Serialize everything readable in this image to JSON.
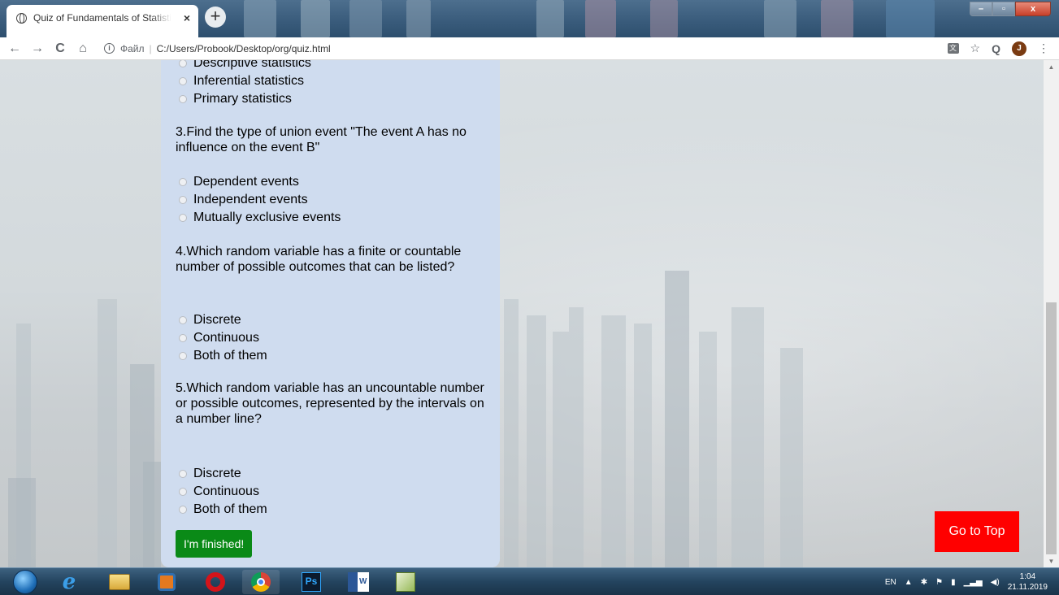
{
  "browser": {
    "tab_title": "Quiz of Fundamentals of Statistic",
    "tab_close": "×",
    "new_tab": "+",
    "window_min": "–",
    "window_max": "▫",
    "window_close": "x"
  },
  "toolbar": {
    "back": "←",
    "forward": "→",
    "reload": "C",
    "home": "⌂",
    "info": "i",
    "scheme_label": "Файл",
    "separator": "|",
    "url": "C:/Users/Probook/Desktop/org/quiz.html",
    "star": "☆",
    "search": "Q",
    "avatar_letter": "J",
    "menu": "⋮"
  },
  "quiz": {
    "partial_options": [
      "Descriptive statistics",
      "Inferential statistics",
      "Primary statistics"
    ],
    "questions": [
      {
        "text": "3.Find the type of union event \"The event A has no influence on the event B\"",
        "options": [
          "Dependent events",
          "Independent events",
          "Mutually exclusive events"
        ]
      },
      {
        "text": "4.Which random variable has a finite or countable number of possible outcomes that can be listed?",
        "options": [
          "Discrete",
          "Continuous",
          "Both of them"
        ]
      },
      {
        "text": "5.Which random variable has an uncountable number or possible outcomes, represented by the intervals on a number line?",
        "options": [
          "Discrete",
          "Continuous",
          "Both of them"
        ]
      }
    ],
    "finish_label": "I'm finished!",
    "go_top_label": "Go to Top"
  },
  "taskbar": {
    "ps_label": "Ps",
    "word_label": "W",
    "language": "EN",
    "time": "1:04",
    "date": "21.11.2019"
  },
  "colors": {
    "panel": "#cfdcef",
    "finish_button": "#0a8a17",
    "go_top_button": "#ff0000"
  },
  "icons": [
    "globe-icon",
    "back-arrow-icon",
    "forward-arrow-icon",
    "reload-icon",
    "home-icon",
    "info-icon",
    "translate-icon",
    "star-icon",
    "search-icon",
    "kebab-menu-icon",
    "windows-start-icon",
    "ie-icon",
    "explorer-folder-icon",
    "media-player-icon",
    "opera-icon",
    "chrome-icon",
    "photoshop-icon",
    "word-icon",
    "project-icon"
  ]
}
